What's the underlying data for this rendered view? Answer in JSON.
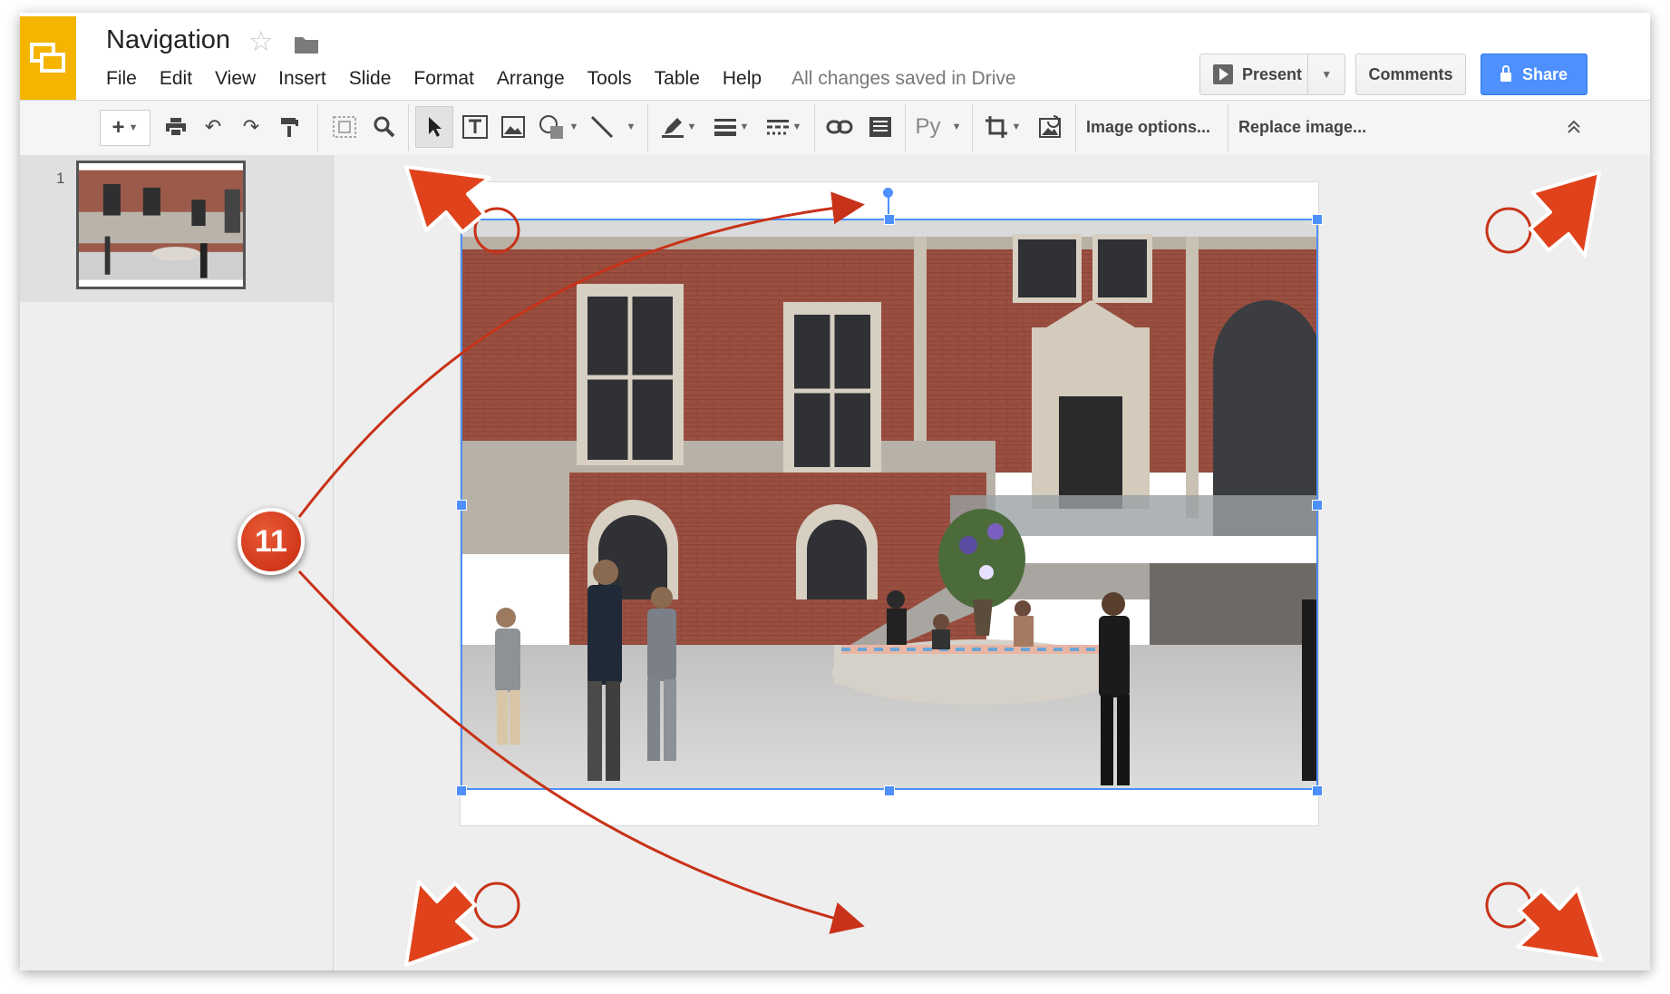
{
  "app": {
    "doc_title": "Navigation",
    "menu": [
      "File",
      "Edit",
      "View",
      "Insert",
      "Slide",
      "Format",
      "Arrange",
      "Tools",
      "Table",
      "Help"
    ],
    "save_status": "All changes saved in Drive",
    "present_label": "Present",
    "comments_label": "Comments",
    "share_label": "Share",
    "accent_color": "#4d90fe",
    "logo_color": "#f4b400"
  },
  "toolbar": {
    "new_slide_icon": "plus-icon",
    "image_options_label": "Image options...",
    "replace_image_label": "Replace image...",
    "spell_label": "Py"
  },
  "filmstrip": {
    "slides": [
      {
        "number": "1"
      }
    ]
  },
  "annotation": {
    "callout_number": "11",
    "arrow_color": "#e0421c"
  }
}
